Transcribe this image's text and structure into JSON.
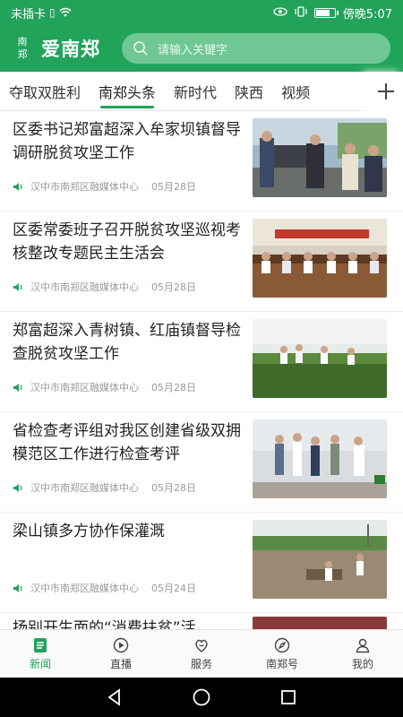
{
  "status_bar": {
    "carrier": "未插卡",
    "time": "傍晚5:07"
  },
  "header": {
    "logo_mark_top": "南",
    "logo_mark_bottom": "郑",
    "app_name": "爱南郑",
    "search_placeholder": "请输入关键字"
  },
  "tabs": [
    {
      "label": "夺取双胜利"
    },
    {
      "label": "南郑头条",
      "active": true
    },
    {
      "label": "新时代"
    },
    {
      "label": "陕西"
    },
    {
      "label": "视频"
    }
  ],
  "news": [
    {
      "title": "区委书记郑富超深入牟家坝镇督导调研脱贫攻坚工作",
      "source": "汉中市南郑区融媒体中心",
      "date": "05月28日"
    },
    {
      "title": "区委常委班子召开脱贫攻坚巡视考核整改专题民主生活会",
      "source": "汉中市南郑区融媒体中心",
      "date": "05月28日"
    },
    {
      "title": "郑富超深入青树镇、红庙镇督导检查脱贫攻坚工作",
      "source": "汉中市南郑区融媒体中心",
      "date": "05月28日"
    },
    {
      "title": "省检查考评组对我区创建省级双拥模范区工作进行检查考评",
      "source": "汉中市南郑区融媒体中心",
      "date": "05月28日"
    },
    {
      "title": "梁山镇多方协作保灌溉",
      "source": "汉中市南郑区融媒体中心",
      "date": "05月24日"
    },
    {
      "title": "扬别开生面的“消费扶贫”活",
      "source": "",
      "date": ""
    }
  ],
  "bottom_nav": [
    {
      "label": "新闻",
      "icon": "news-icon",
      "active": true
    },
    {
      "label": "直播",
      "icon": "live-icon"
    },
    {
      "label": "服务",
      "icon": "service-icon"
    },
    {
      "label": "南郑号",
      "icon": "compass-icon"
    },
    {
      "label": "我的",
      "icon": "profile-icon"
    }
  ],
  "colors": {
    "brand": "#22a35a",
    "search_bg": "#6fc893"
  }
}
